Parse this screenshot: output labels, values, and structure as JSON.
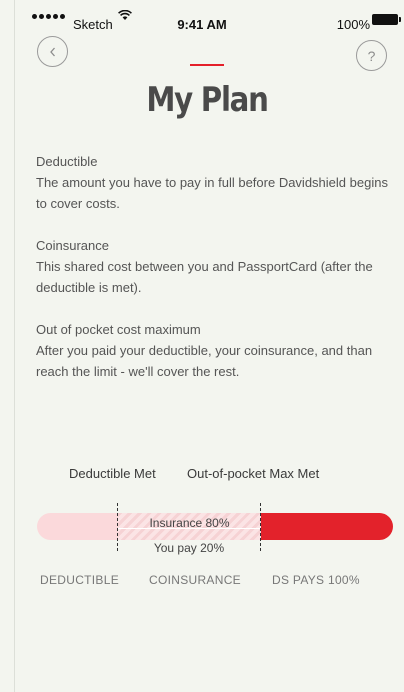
{
  "status_bar": {
    "carrier": "Sketch",
    "time": "9:41 AM",
    "battery": "100%"
  },
  "nav": {
    "back_icon": "chevron-left-icon",
    "help_label": "?"
  },
  "page": {
    "title": "My Plan"
  },
  "definitions": [
    {
      "term": "Deductible",
      "text": "The amount you have to pay in full before Davidshield begins to cover costs."
    },
    {
      "term": "Coinsurance",
      "text": "This shared cost between you and PassportCard (after the deductible is met)."
    },
    {
      "term": "Out of pocket cost maximum",
      "text": "After you paid your deductible, your coinsurance, and than reach the limit -  we'll cover the rest."
    }
  ],
  "progress": {
    "milestones": [
      "Deductible Met",
      "Out-of-pocket Max Met"
    ],
    "insurance_label": "Insurance 80%",
    "you_pay_label": "You pay 20%",
    "segments": [
      "DEDUCTIBLE",
      "COINSURANCE",
      "DS PAYS 100%"
    ],
    "colors": {
      "deductible": "#fbd9db",
      "coinsurance": "#f6d2d4",
      "ds_pays": "#e3222b",
      "accent": "#e4202a"
    }
  }
}
